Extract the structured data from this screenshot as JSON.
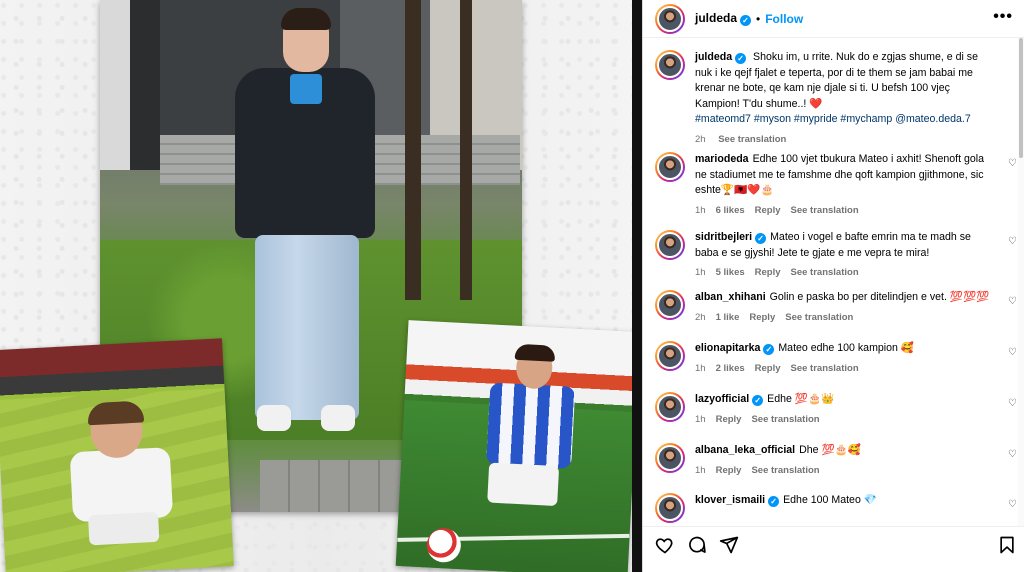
{
  "post": {
    "username": "juldeda",
    "follow_label": "Follow",
    "dot": "•",
    "more_label": "•••",
    "caption": {
      "username": "juldeda",
      "text": "Shoku im, u rrite. Nuk do e zgjas shume, e di se nuk i ke qejf fjalet e teperta, por di te them se jam babai me krenar ne bote, qe kam nje djale si ti. U befsh 100 vjeç Kampion! T'du shume..!",
      "heart": "❤️",
      "tags": "#mateomd7 #myson #mypride #mychamp @mateo.deda.7",
      "time": "2h",
      "translation": "See translation"
    }
  },
  "comments": [
    {
      "username": "mariodeda",
      "verified": false,
      "text": "Edhe 100 vjet tbukura Mateo i axhit! Shenoft gola ne stadiumet me te famshme dhe qoft kampion gjithmone, sic eshte🏆🇦🇱❤️🎂",
      "time": "1h",
      "likes": "6 likes",
      "reply": "Reply",
      "translation": "See translation"
    },
    {
      "username": "sidritbejleri",
      "verified": true,
      "text": "Mateo i vogel e bafte emrin ma te madh se baba e se gjyshi! Jete te gjate e me vepra te mira!",
      "time": "1h",
      "likes": "5 likes",
      "reply": "Reply",
      "translation": "See translation"
    },
    {
      "username": "alban_xhihani",
      "verified": false,
      "text": "Golin e paska bo per ditelindjen e vet. 💯💯💯",
      "time": "2h",
      "likes": "1 like",
      "reply": "Reply",
      "translation": "See translation"
    },
    {
      "username": "elionapitarka",
      "verified": true,
      "text": "Mateo edhe 100 kampion 🥰",
      "time": "1h",
      "likes": "2 likes",
      "reply": "Reply",
      "translation": "See translation"
    },
    {
      "username": "lazyofficial",
      "verified": true,
      "text": "Edhe 💯🎂👑",
      "time": "1h",
      "likes": "",
      "reply": "Reply",
      "translation": "See translation"
    },
    {
      "username": "albana_leka_official",
      "verified": false,
      "text": "Dhe 💯🎂🥰",
      "time": "1h",
      "likes": "",
      "reply": "Reply",
      "translation": "See translation"
    },
    {
      "username": "klover_ismaili",
      "verified": true,
      "text": "Edhe 100 Mateo 💎",
      "time": "",
      "likes": "",
      "reply": "",
      "translation": ""
    }
  ],
  "icons": [
    "heart-icon",
    "comment-icon",
    "share-icon",
    "bookmark-icon",
    "more-options-icon",
    "verified-badge-icon"
  ],
  "colors": {
    "link": "#0095f6",
    "tag": "#00376b",
    "muted": "#737373"
  }
}
